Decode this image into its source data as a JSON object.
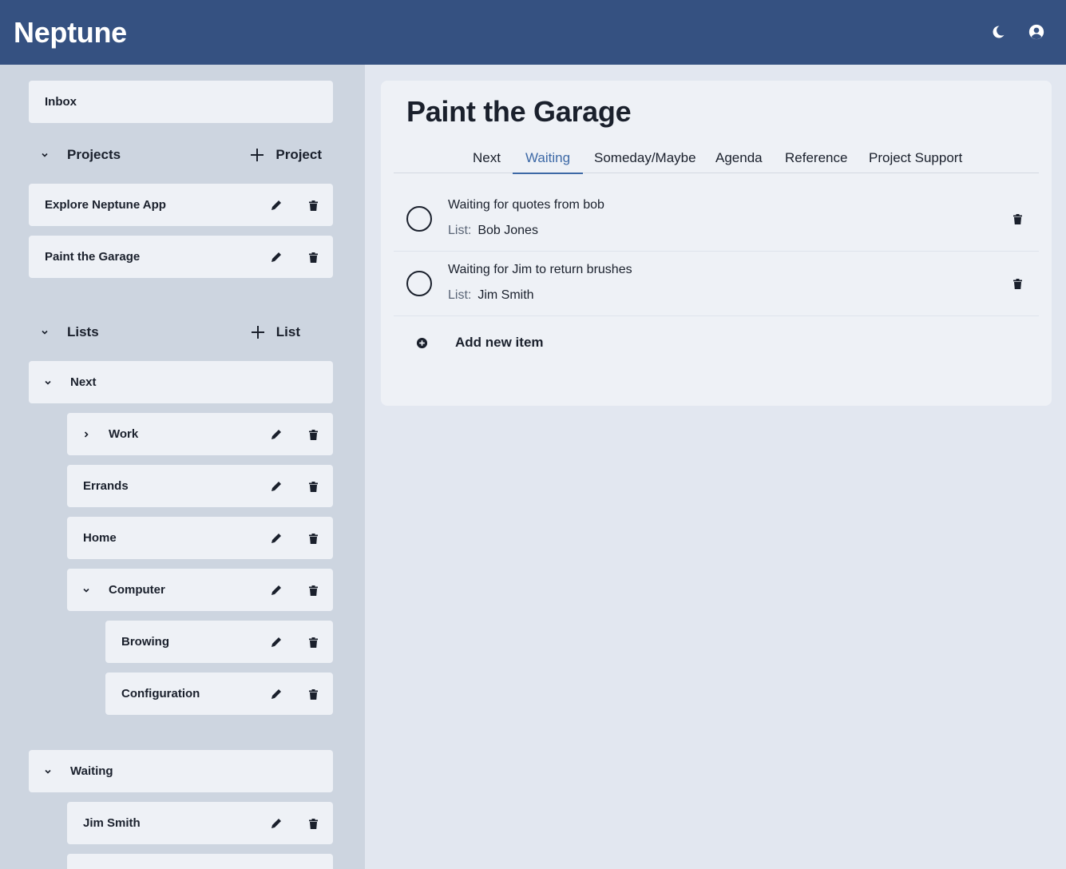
{
  "app": {
    "title": "Neptune"
  },
  "header": {
    "icons": [
      "moon-icon",
      "user-circle-icon"
    ]
  },
  "sidebar": {
    "inbox_label": "Inbox",
    "projects_section": {
      "title": "Projects",
      "add_label": "Project"
    },
    "projects": [
      {
        "label": "Explore Neptune App"
      },
      {
        "label": "Paint the Garage"
      }
    ],
    "lists_section": {
      "title": "Lists",
      "add_label": "List"
    },
    "lists": {
      "next": {
        "label": "Next",
        "children": {
          "work": "Work",
          "errands": "Errands",
          "home": "Home",
          "computer": "Computer",
          "browing": "Browing",
          "configuration": "Configuration"
        }
      },
      "waiting": {
        "label": "Waiting",
        "children": {
          "jim_smith": "Jim Smith"
        }
      }
    }
  },
  "main": {
    "title": "Paint the Garage",
    "tabs": [
      "Next",
      "Waiting",
      "Someday/Maybe",
      "Agenda",
      "Reference",
      "Project Support"
    ],
    "active_tab": "Waiting",
    "list_key": "List:",
    "items": [
      {
        "text": "Waiting for quotes from bob",
        "list": "Bob Jones"
      },
      {
        "text": "Waiting for Jim to return brushes",
        "list": "Jim Smith"
      }
    ],
    "add_item_label": "Add new item"
  },
  "colors": {
    "header": "#355181",
    "sidebar": "#cdd5e0",
    "card": "#eef1f6",
    "active_tab": "#3d69a6",
    "background": "#e2e7f0"
  }
}
